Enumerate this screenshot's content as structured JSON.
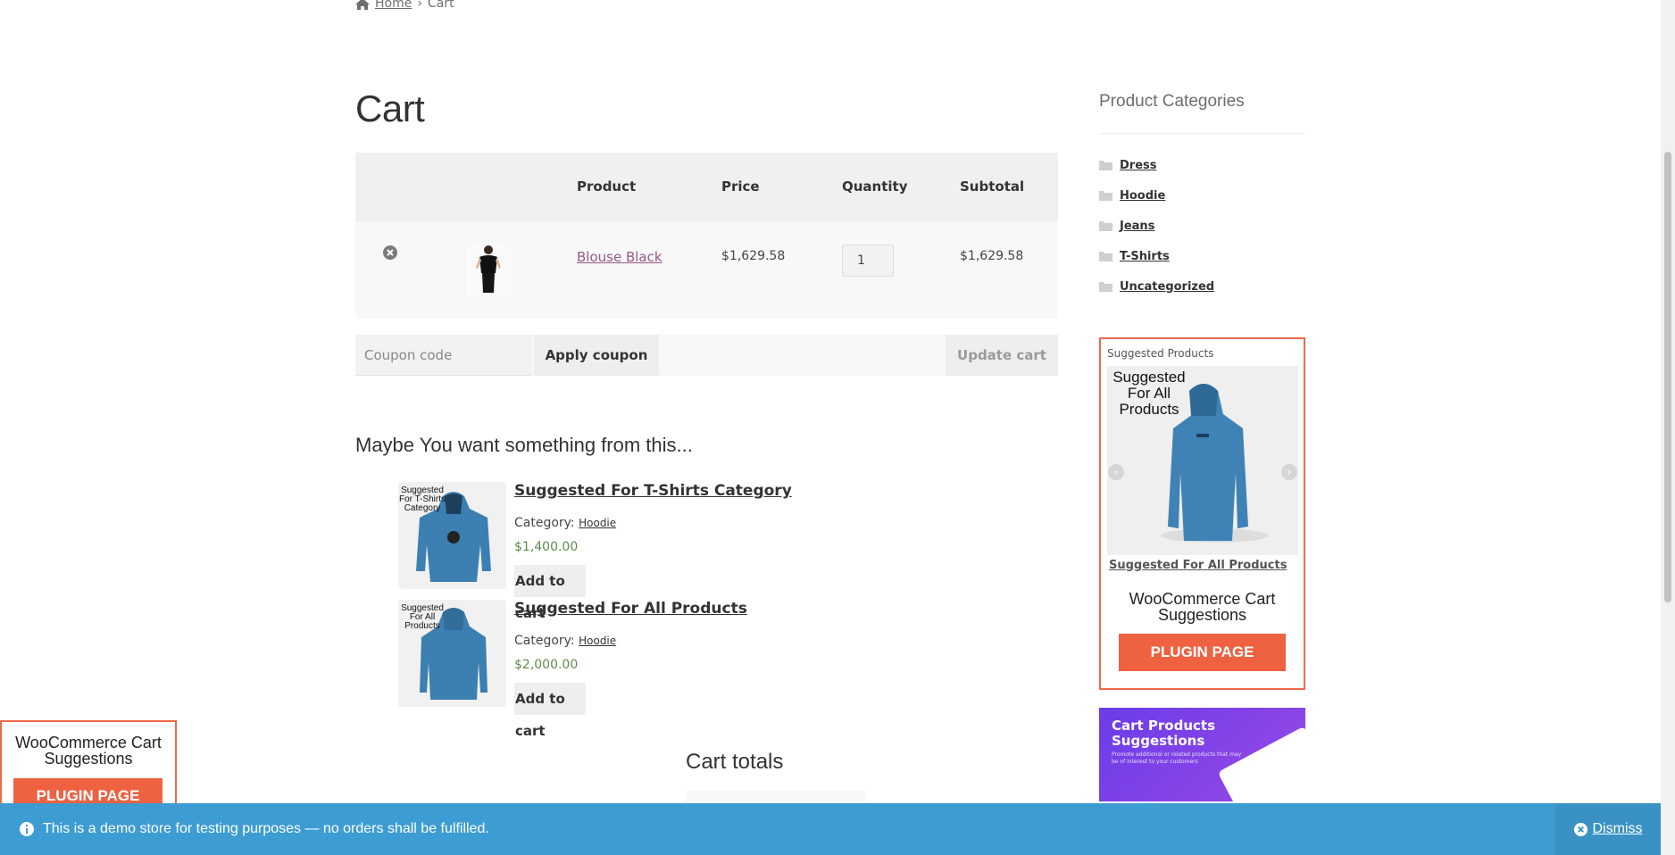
{
  "breadcrumb": {
    "home": "Home",
    "sep": "›",
    "current": "Cart"
  },
  "page_title": "Cart",
  "cart_table": {
    "headers": {
      "product": "Product",
      "price": "Price",
      "quantity": "Quantity",
      "subtotal": "Subtotal"
    },
    "rows": [
      {
        "product": "Blouse Black",
        "price": "$1,629.58",
        "quantity": "1",
        "subtotal": "$1,629.58"
      }
    ]
  },
  "actions": {
    "coupon_placeholder": "Coupon code",
    "apply": "Apply coupon",
    "update": "Update cart"
  },
  "suggestions": {
    "heading": "Maybe You want something from this...",
    "items": [
      {
        "img_text": "Suggested For T-Shirts Category",
        "title": "Suggested For T-Shirts Category",
        "category_label": "Category:",
        "category": "Hoodie",
        "price": "$1,400.00",
        "add": "Add to cart"
      },
      {
        "img_text": "Suggested For All Products",
        "title": "Suggested For All Products",
        "category_label": "Category:",
        "category": "Hoodie",
        "price": "$2,000.00",
        "add": "Add to cart"
      }
    ]
  },
  "cart_totals": "Cart totals",
  "sidebar": {
    "categories_title": "Product Categories",
    "categories": [
      "Dress",
      "Hoodie",
      "Jeans",
      "T-Shirts",
      "Uncategorized"
    ],
    "widget": {
      "title": "Suggested Products",
      "slide_text": "Suggested For All Products",
      "link": "Suggested For All Products",
      "plugin_name": "WooCommerce Cart Suggestions",
      "plugin_button": "PLUGIN PAGE"
    },
    "promo": {
      "title": "Cart Products Suggestions",
      "text": "Promote additional or related products that may be of interest to your customers"
    }
  },
  "float_box": {
    "plugin_name": "WooCommerce Cart Suggestions",
    "plugin_button": "PLUGIN PAGE"
  },
  "notice": {
    "text": "This is a demo store for testing purposes — no orders shall be fulfilled.",
    "dismiss": "Dismiss"
  },
  "colors": {
    "accent": "#ee6242",
    "notice_bg": "#3d9cd2",
    "product_link": "#96588a",
    "price_green": "#5d8b4b"
  }
}
